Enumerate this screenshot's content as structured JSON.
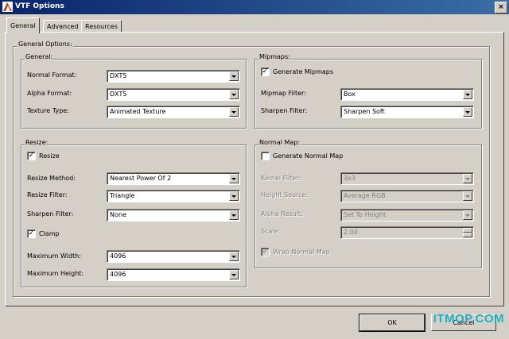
{
  "window": {
    "title": "VTF Options",
    "close_label": "×"
  },
  "tabs": [
    {
      "label": "General"
    },
    {
      "label": "Advanced"
    },
    {
      "label": "Resources"
    }
  ],
  "general_options": {
    "label": "General Options:",
    "general": {
      "label": "General:",
      "normal_format": {
        "label": "Normal Format:",
        "value": "DXT5"
      },
      "alpha_format": {
        "label": "Alpha Format:",
        "value": "DXT5"
      },
      "texture_type": {
        "label": "Texture Type:",
        "value": "Animated Texture"
      }
    },
    "mipmaps": {
      "label": "Mipmaps:",
      "generate": {
        "label": "Generate Mipmaps",
        "checked": "✓"
      },
      "mipmap_filter": {
        "label": "Mipmap Filter:",
        "value": "Box"
      },
      "sharpen_filter": {
        "label": "Sharpen Filter:",
        "value": "Sharpen Soft"
      }
    },
    "resize": {
      "label": "Resize:",
      "resize": {
        "label": "Resize",
        "checked": "✓"
      },
      "resize_method": {
        "label": "Resize Method:",
        "value": "Nearest Power Of 2"
      },
      "resize_filter": {
        "label": "Resize Filter:",
        "value": "Triangle"
      },
      "sharpen_filter": {
        "label": "Sharpen Filter:",
        "value": "None"
      },
      "clamp": {
        "label": "Clamp",
        "checked": "✓"
      },
      "max_width": {
        "label": "Maximum Width:",
        "value": "4096"
      },
      "max_height": {
        "label": "Maximum Height:",
        "value": "4096"
      }
    },
    "normal_map": {
      "label": "Normal Map:",
      "generate": {
        "label": "Generate Normal Map",
        "checked": ""
      },
      "kernel_filter": {
        "label": "Kernel Filter:",
        "value": "3x3"
      },
      "height_source": {
        "label": "Height Source:",
        "value": "Average RGB"
      },
      "alpha_result": {
        "label": "Alpha Result:",
        "value": "Set To Height"
      },
      "scale": {
        "label": "Scale:",
        "value": "2.00"
      },
      "wrap": {
        "label": "Wrap Normal Map",
        "checked": "✓"
      }
    }
  },
  "buttons": {
    "ok": "OK",
    "cancel": "Cancel"
  },
  "watermark": "ITMOP.COM"
}
